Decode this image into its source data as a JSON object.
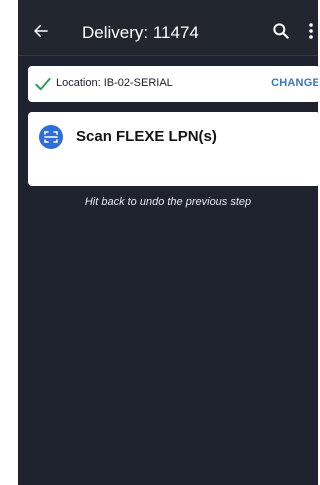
{
  "header": {
    "title": "Delivery: 11474",
    "back_icon": "arrow-left-icon",
    "search_icon": "search-icon",
    "more_icon": "more-vertical-icon"
  },
  "location": {
    "text": "Location: IB-02-SERIAL",
    "action_label": "CHANGE",
    "status_icon": "check-icon"
  },
  "scan_step": {
    "label": "Scan FLEXE LPN(s)",
    "icon": "scan-icon"
  },
  "hint": "Hit back to undo the previous step",
  "colors": {
    "background": "#1f2330",
    "card": "#ffffff",
    "accent": "#3a78b8",
    "check": "#2e9d5a",
    "scan_icon": "#2d6fd6"
  }
}
